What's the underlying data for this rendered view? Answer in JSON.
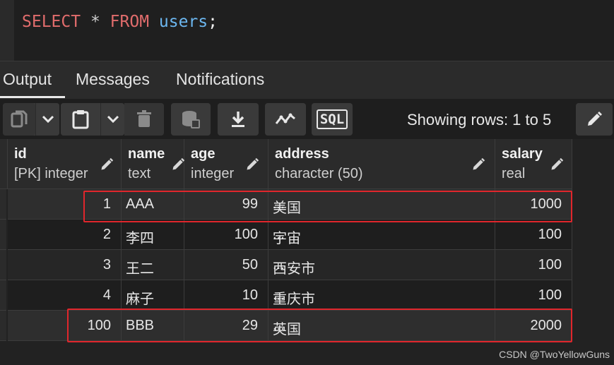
{
  "editor": {
    "kw_select": "SELECT",
    "star": "*",
    "kw_from": "FROM",
    "table": "users",
    "semicolon": ";"
  },
  "tabs": [
    {
      "label": "Output",
      "active": true
    },
    {
      "label": "Messages",
      "active": false
    },
    {
      "label": "Notifications",
      "active": false
    }
  ],
  "toolbar": {
    "sql_label": "SQL",
    "rows_info": "Showing rows: 1 to 5",
    "icons": [
      "copy-icon",
      "chevron-down-icon",
      "paste-icon",
      "chevron-down-icon",
      "delete-icon",
      "save-data-icon",
      "download-icon",
      "graph-icon",
      "sql-icon",
      "edit-icon"
    ]
  },
  "grid": {
    "columns": [
      {
        "name": "id",
        "type": "[PK] integer"
      },
      {
        "name": "name",
        "type": "text"
      },
      {
        "name": "age",
        "type": "integer"
      },
      {
        "name": "address",
        "type": "character (50)"
      },
      {
        "name": "salary",
        "type": "real"
      }
    ],
    "rows": [
      {
        "id": "1",
        "name": "AAA",
        "age": "99",
        "address": "美国",
        "ellipsis": "...",
        "salary": "1000"
      },
      {
        "id": "2",
        "name": "李四",
        "age": "100",
        "address": "宇宙",
        "ellipsis": "...",
        "salary": "100"
      },
      {
        "id": "3",
        "name": "王二",
        "age": "50",
        "address": "西安市",
        "ellipsis": "...",
        "salary": "100"
      },
      {
        "id": "4",
        "name": "麻子",
        "age": "10",
        "address": "重庆市",
        "ellipsis": "...",
        "salary": "100"
      },
      {
        "id": "100",
        "name": "BBB",
        "age": "29",
        "address": "英国",
        "ellipsis": "...",
        "salary": "2000"
      }
    ]
  },
  "colors": {
    "highlight": "#e0262c",
    "keyword": "#e06c6c",
    "table": "#6cb7f0"
  },
  "watermark": "CSDN @TwoYellowGuns"
}
